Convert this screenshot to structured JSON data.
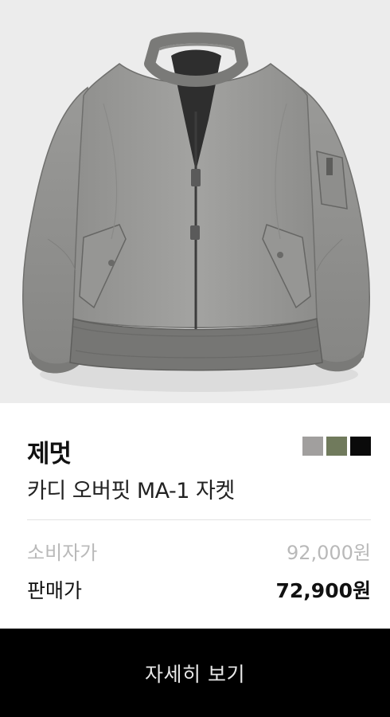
{
  "product": {
    "brand": "제멋",
    "name": "카디 오버핏 MA-1 자켓",
    "colors": [
      {
        "name": "gray",
        "hex": "#a19f9e"
      },
      {
        "name": "olive",
        "hex": "#707a5c"
      },
      {
        "name": "black",
        "hex": "#0a0a0a"
      }
    ],
    "msrp_label": "소비자가",
    "msrp_value": "92,000원",
    "sale_label": "판매가",
    "sale_value": "72,900원",
    "detail_button_label": "자세히 보기"
  }
}
